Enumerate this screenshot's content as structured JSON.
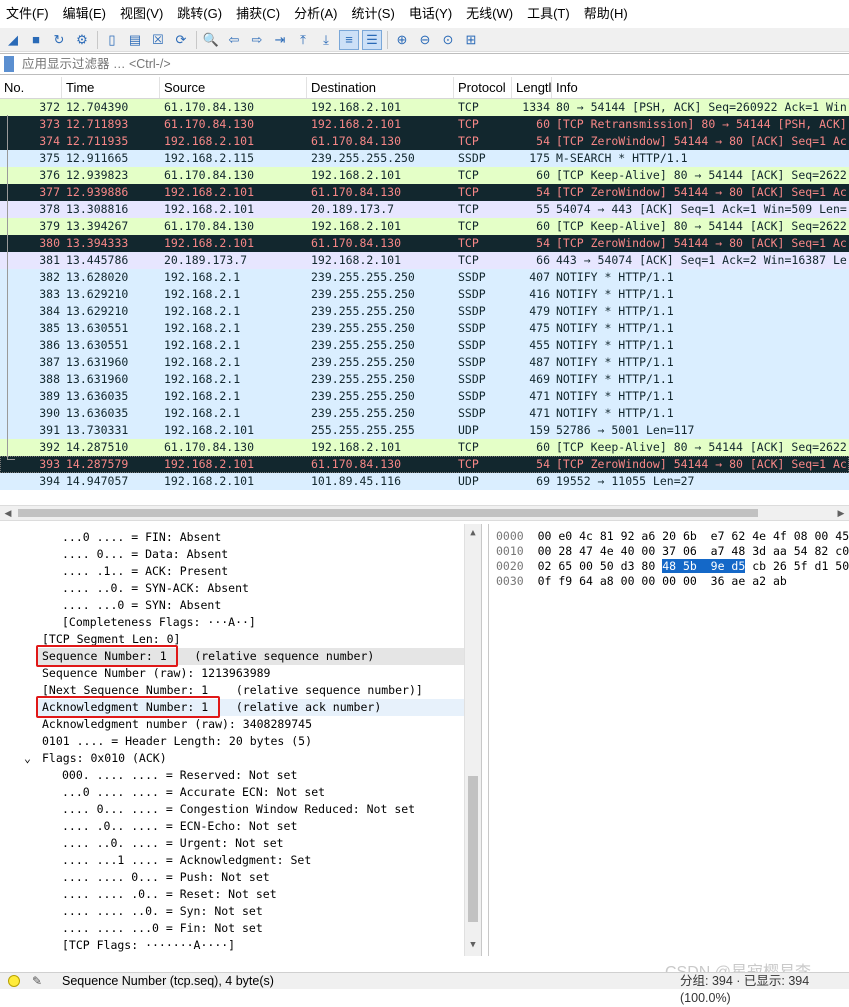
{
  "menu": [
    "文件(F)",
    "编辑(E)",
    "视图(V)",
    "跳转(G)",
    "捕获(C)",
    "分析(A)",
    "统计(S)",
    "电话(Y)",
    "无线(W)",
    "工具(T)",
    "帮助(H)"
  ],
  "toolbar": {
    "buttons": [
      {
        "icon": "shark-fin-start-icon",
        "glyph": "◢"
      },
      {
        "icon": "stop-capture-icon",
        "glyph": "■"
      },
      {
        "icon": "restart-capture-icon",
        "glyph": "↻"
      },
      {
        "icon": "capture-options-icon",
        "glyph": "⚙"
      },
      {
        "sep": true
      },
      {
        "icon": "open-file-icon",
        "glyph": "▯"
      },
      {
        "icon": "save-file-icon",
        "glyph": "▤"
      },
      {
        "icon": "close-file-icon",
        "glyph": "☒"
      },
      {
        "icon": "reload-icon",
        "glyph": "⟳"
      },
      {
        "sep": true
      },
      {
        "icon": "find-packet-icon",
        "glyph": "🔍"
      },
      {
        "icon": "go-back-icon",
        "glyph": "⇦"
      },
      {
        "icon": "go-forward-icon",
        "glyph": "⇨"
      },
      {
        "icon": "go-to-packet-icon",
        "glyph": "⇥"
      },
      {
        "icon": "go-first-icon",
        "glyph": "⤒"
      },
      {
        "icon": "go-last-icon",
        "glyph": "⤓"
      },
      {
        "icon": "autoscroll-icon",
        "glyph": "≡",
        "selected": true
      },
      {
        "icon": "colorize-icon",
        "glyph": "☰",
        "selected": true
      },
      {
        "sep": true
      },
      {
        "icon": "zoom-in-icon",
        "glyph": "⊕"
      },
      {
        "icon": "zoom-out-icon",
        "glyph": "⊖"
      },
      {
        "icon": "zoom-normal-icon",
        "glyph": "⊙"
      },
      {
        "icon": "resize-columns-icon",
        "glyph": "⊞"
      }
    ]
  },
  "filter": {
    "placeholder": "应用显示过滤器 … <Ctrl-/>"
  },
  "packet_list": {
    "headers": {
      "no": "No.",
      "time": "Time",
      "source": "Source",
      "destination": "Destination",
      "protocol": "Protocol",
      "length": "Lengtl",
      "info": "Info"
    },
    "rows": [
      {
        "no": "372",
        "time": "12.704390",
        "src": "61.170.84.130",
        "dst": "192.168.2.101",
        "proto": "TCP",
        "len": "1334",
        "info": "80 → 54144 [PSH, ACK] Seq=260922 Ack=1 Win",
        "style": "green"
      },
      {
        "no": "373",
        "time": "12.711893",
        "src": "61.170.84.130",
        "dst": "192.168.2.101",
        "proto": "TCP",
        "len": "60",
        "info": "[TCP Retransmission] 80 → 54144 [PSH, ACK]",
        "style": "dark"
      },
      {
        "no": "374",
        "time": "12.711935",
        "src": "192.168.2.101",
        "dst": "61.170.84.130",
        "proto": "TCP",
        "len": "54",
        "info": "[TCP ZeroWindow] 54144 → 80 [ACK] Seq=1 Ac",
        "style": "dark"
      },
      {
        "no": "375",
        "time": "12.911665",
        "src": "192.168.2.115",
        "dst": "239.255.255.250",
        "proto": "SSDP",
        "len": "175",
        "info": "M-SEARCH * HTTP/1.1",
        "style": "blue"
      },
      {
        "no": "376",
        "time": "12.939823",
        "src": "61.170.84.130",
        "dst": "192.168.2.101",
        "proto": "TCP",
        "len": "60",
        "info": "[TCP Keep-Alive] 80 → 54144 [ACK] Seq=2622",
        "style": "green"
      },
      {
        "no": "377",
        "time": "12.939886",
        "src": "192.168.2.101",
        "dst": "61.170.84.130",
        "proto": "TCP",
        "len": "54",
        "info": "[TCP ZeroWindow] 54144 → 80 [ACK] Seq=1 Ac",
        "style": "dark"
      },
      {
        "no": "378",
        "time": "13.308816",
        "src": "192.168.2.101",
        "dst": "20.189.173.7",
        "proto": "TCP",
        "len": "55",
        "info": "54074 → 443 [ACK] Seq=1 Ack=1 Win=509 Len=",
        "style": "lav"
      },
      {
        "no": "379",
        "time": "13.394267",
        "src": "61.170.84.130",
        "dst": "192.168.2.101",
        "proto": "TCP",
        "len": "60",
        "info": "[TCP Keep-Alive] 80 → 54144 [ACK] Seq=2622",
        "style": "green"
      },
      {
        "no": "380",
        "time": "13.394333",
        "src": "192.168.2.101",
        "dst": "61.170.84.130",
        "proto": "TCP",
        "len": "54",
        "info": "[TCP ZeroWindow] 54144 → 80 [ACK] Seq=1 Ac",
        "style": "dark"
      },
      {
        "no": "381",
        "time": "13.445786",
        "src": "20.189.173.7",
        "dst": "192.168.2.101",
        "proto": "TCP",
        "len": "66",
        "info": "443 → 54074 [ACK] Seq=1 Ack=2 Win=16387 Le",
        "style": "lav"
      },
      {
        "no": "382",
        "time": "13.628020",
        "src": "192.168.2.1",
        "dst": "239.255.255.250",
        "proto": "SSDP",
        "len": "407",
        "info": "NOTIFY * HTTP/1.1",
        "style": "blue"
      },
      {
        "no": "383",
        "time": "13.629210",
        "src": "192.168.2.1",
        "dst": "239.255.255.250",
        "proto": "SSDP",
        "len": "416",
        "info": "NOTIFY * HTTP/1.1",
        "style": "blue"
      },
      {
        "no": "384",
        "time": "13.629210",
        "src": "192.168.2.1",
        "dst": "239.255.255.250",
        "proto": "SSDP",
        "len": "479",
        "info": "NOTIFY * HTTP/1.1",
        "style": "blue"
      },
      {
        "no": "385",
        "time": "13.630551",
        "src": "192.168.2.1",
        "dst": "239.255.255.250",
        "proto": "SSDP",
        "len": "475",
        "info": "NOTIFY * HTTP/1.1",
        "style": "blue"
      },
      {
        "no": "386",
        "time": "13.630551",
        "src": "192.168.2.1",
        "dst": "239.255.255.250",
        "proto": "SSDP",
        "len": "455",
        "info": "NOTIFY * HTTP/1.1",
        "style": "blue"
      },
      {
        "no": "387",
        "time": "13.631960",
        "src": "192.168.2.1",
        "dst": "239.255.255.250",
        "proto": "SSDP",
        "len": "487",
        "info": "NOTIFY * HTTP/1.1",
        "style": "blue"
      },
      {
        "no": "388",
        "time": "13.631960",
        "src": "192.168.2.1",
        "dst": "239.255.255.250",
        "proto": "SSDP",
        "len": "469",
        "info": "NOTIFY * HTTP/1.1",
        "style": "blue"
      },
      {
        "no": "389",
        "time": "13.636035",
        "src": "192.168.2.1",
        "dst": "239.255.255.250",
        "proto": "SSDP",
        "len": "471",
        "info": "NOTIFY * HTTP/1.1",
        "style": "blue"
      },
      {
        "no": "390",
        "time": "13.636035",
        "src": "192.168.2.1",
        "dst": "239.255.255.250",
        "proto": "SSDP",
        "len": "471",
        "info": "NOTIFY * HTTP/1.1",
        "style": "blue"
      },
      {
        "no": "391",
        "time": "13.730331",
        "src": "192.168.2.101",
        "dst": "255.255.255.255",
        "proto": "UDP",
        "len": "159",
        "info": "52786 → 5001 Len=117",
        "style": "blue"
      },
      {
        "no": "392",
        "time": "14.287510",
        "src": "61.170.84.130",
        "dst": "192.168.2.101",
        "proto": "TCP",
        "len": "60",
        "info": "[TCP Keep-Alive] 80 → 54144 [ACK] Seq=2622",
        "style": "green"
      },
      {
        "no": "393",
        "time": "14.287579",
        "src": "192.168.2.101",
        "dst": "61.170.84.130",
        "proto": "TCP",
        "len": "54",
        "info": "[TCP ZeroWindow] 54144 → 80 [ACK] Seq=1 Ac",
        "style": "dark",
        "selected": true
      },
      {
        "no": "394",
        "time": "14.947057",
        "src": "192.168.2.101",
        "dst": "101.89.45.116",
        "proto": "UDP",
        "len": "69",
        "info": "19552 → 11055 Len=27",
        "style": "blue"
      }
    ]
  },
  "details": {
    "lines": [
      {
        "indent": 2,
        "text": "...0 .... = FIN: Absent"
      },
      {
        "indent": 2,
        "text": ".... 0... = Data: Absent"
      },
      {
        "indent": 2,
        "text": ".... .1.. = ACK: Present"
      },
      {
        "indent": 2,
        "text": ".... ..0. = SYN-ACK: Absent"
      },
      {
        "indent": 2,
        "text": ".... ...0 = SYN: Absent"
      },
      {
        "indent": 2,
        "text": "[Completeness Flags: ···A··]"
      },
      {
        "indent": 1,
        "text": "[TCP Segment Len: 0]"
      },
      {
        "indent": 1,
        "text": "Sequence Number: 1    (relative sequence number)",
        "hl": "gray",
        "box": true
      },
      {
        "indent": 1,
        "text": "Sequence Number (raw): 1213963989"
      },
      {
        "indent": 1,
        "text": "[Next Sequence Number: 1    (relative sequence number)]"
      },
      {
        "indent": 1,
        "text": "Acknowledgment Number: 1    (relative ack number)",
        "hl": "blue",
        "box": true
      },
      {
        "indent": 1,
        "text": "Acknowledgment number (raw): 3408289745"
      },
      {
        "indent": 1,
        "text": "0101 .... = Header Length: 20 bytes (5)"
      },
      {
        "indent": 1,
        "text": "Flags: 0x010 (ACK)",
        "expander": "v"
      },
      {
        "indent": 2,
        "text": "000. .... .... = Reserved: Not set"
      },
      {
        "indent": 2,
        "text": "...0 .... .... = Accurate ECN: Not set"
      },
      {
        "indent": 2,
        "text": ".... 0... .... = Congestion Window Reduced: Not set"
      },
      {
        "indent": 2,
        "text": ".... .0.. .... = ECN-Echo: Not set"
      },
      {
        "indent": 2,
        "text": ".... ..0. .... = Urgent: Not set"
      },
      {
        "indent": 2,
        "text": ".... ...1 .... = Acknowledgment: Set"
      },
      {
        "indent": 2,
        "text": ".... .... 0... = Push: Not set"
      },
      {
        "indent": 2,
        "text": ".... .... .0.. = Reset: Not set"
      },
      {
        "indent": 2,
        "text": ".... .... ..0. = Syn: Not set"
      },
      {
        "indent": 2,
        "text": ".... .... ...0 = Fin: Not set"
      },
      {
        "indent": 2,
        "text": "[TCP Flags: ·······A····]"
      }
    ]
  },
  "bytes": {
    "rows": [
      {
        "offset": "0000",
        "pre": "00 e0 4c 81 92 a6 20 6b  e7 62 4e 4f 08 00 45",
        "hl": "",
        "post": ""
      },
      {
        "offset": "0010",
        "pre": "00 28 47 4e 40 00 37 06  a7 48 3d aa 54 82 c0",
        "hl": "",
        "post": ""
      },
      {
        "offset": "0020",
        "pre": "02 65 00 50 d3 80 ",
        "hl": "48 5b  9e d5",
        "post": " cb 26 5f d1 50"
      },
      {
        "offset": "0030",
        "pre": "0f f9 64 a8 00 00 00 00  36 ae a2 ab",
        "hl": "",
        "post": ""
      }
    ]
  },
  "status": {
    "field": "Sequence Number (tcp.seq), 4 byte(s)",
    "counts": "分组: 394 · 已显示: 394 (100.0%)"
  },
  "watermark": "CSDN @星寂樱易李",
  "colors": {
    "row_green": "#e4ffc7",
    "row_dark": "#12272e",
    "row_dark_text": "#f78787",
    "row_blue": "#daeeff",
    "row_lavender": "#e7e6ff",
    "annotation_red": "#e01818",
    "byte_highlight": "#1468c8"
  }
}
